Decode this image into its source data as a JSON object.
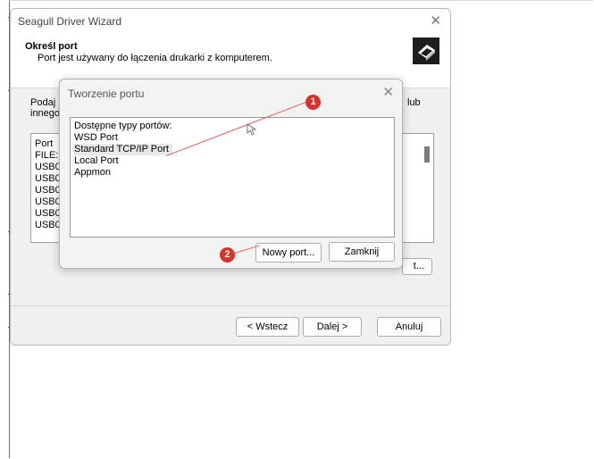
{
  "wizard": {
    "title": "Seagull Driver Wizard",
    "close_glyph": "✕",
    "heading": "Określ port",
    "subheading": "Port jest używany do łączenia drukarki z komputerem.",
    "body_line1": "Podaj p",
    "body_line2": "innego",
    "body_right": "lub",
    "port_list": [
      "Port",
      "FILE:",
      "USB0",
      "USB0",
      "USB0",
      "USB0",
      "USB0",
      "USB0"
    ],
    "ghost_button_label": "t...",
    "buttons": {
      "back": "< Wstecz",
      "next": "Dalej >",
      "cancel": "Anuluj"
    },
    "icon": "printer-icon"
  },
  "dialog": {
    "title": "Tworzenie portu",
    "close_glyph": "✕",
    "list_items": [
      "Dostępne typy portów:",
      "WSD Port",
      "Standard TCP/IP Port",
      "Local Port",
      "Appmon"
    ],
    "selected_index": 2,
    "buttons": {
      "new_port": "Nowy port...",
      "close": "Zamknij"
    }
  },
  "annotations": {
    "badge1": "1",
    "badge2": "2",
    "color": "#d9322b"
  }
}
